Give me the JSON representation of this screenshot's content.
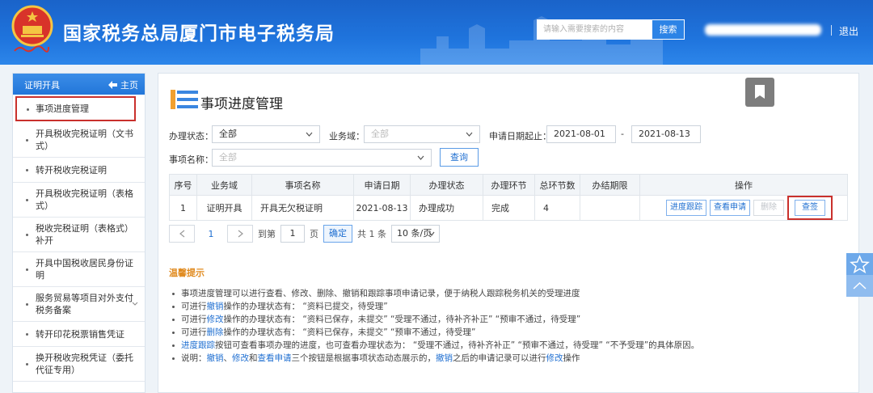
{
  "header": {
    "site_title": "国家税务总局厦门市电子税务局",
    "search_placeholder": "请输入需要搜索的内容",
    "search_button": "搜索",
    "logout": "退出",
    "emblem_text": "中国税务"
  },
  "sidebar": {
    "title": "证明开具",
    "home": "主页",
    "items": [
      {
        "label": "事项进度管理",
        "active": true
      },
      {
        "label": "开具税收完税证明（文书式）"
      },
      {
        "label": "转开税收完税证明"
      },
      {
        "label": "开具税收完税证明（表格式）"
      },
      {
        "label": "税收完税证明（表格式）补开"
      },
      {
        "label": "开具中国税收居民身份证明"
      },
      {
        "label": "服务贸易等项目对外支付税务备案",
        "has_submenu": true
      },
      {
        "label": "转开印花税票销售凭证"
      },
      {
        "label": "换开税收完税凭证（委托代征专用）"
      }
    ]
  },
  "main": {
    "page_title": "事项进度管理",
    "filters": {
      "status_label": "办理状态：",
      "status_value": "全部",
      "domain_label": "业务域：",
      "domain_value": "全部",
      "date_label": "申请日期起止：",
      "date_from": "2021-08-01",
      "date_sep": "-",
      "date_to": "2021-08-13",
      "item_label": "事项名称：",
      "item_value": "全部",
      "query_button": "查询"
    },
    "table": {
      "headers": [
        "序号",
        "业务域",
        "事项名称",
        "申请日期",
        "办理状态",
        "办理环节",
        "总环节数",
        "办结期限",
        "操作"
      ],
      "rows": [
        {
          "index": "1",
          "domain": "证明开具",
          "item": "开具无欠税证明",
          "date": "2021-08-13",
          "status": "办理成功",
          "step": "完成",
          "total_steps": "4",
          "deadline": "",
          "actions": {
            "track": "进度跟踪",
            "view": "查看申请",
            "delete": "删除",
            "sign": "查签"
          }
        }
      ]
    },
    "pager": {
      "current_page": "1",
      "goto_prefix": "到第",
      "goto_value": "1",
      "goto_suffix": "页",
      "confirm": "确定",
      "total": "共 1 条",
      "page_size": "10 条/页"
    },
    "tips": {
      "title": "温馨提示",
      "lines": [
        {
          "parts": [
            {
              "t": "事项进度管理可以进行查看、修改、删除、撤销和跟踪事项申请记录，便于纳税人跟踪税务机关的受理进度"
            }
          ]
        },
        {
          "parts": [
            {
              "t": "可进行"
            },
            {
              "t": "撤销",
              "link": true
            },
            {
              "t": "操作的办理状态有：   “资料已提交，待受理”"
            }
          ]
        },
        {
          "parts": [
            {
              "t": "可进行"
            },
            {
              "t": "修改",
              "link": true
            },
            {
              "t": "操作的办理状态有：   “资料已保存，未提交”    “受理不通过，待补齐补正”    “预审不通过，待受理”"
            }
          ]
        },
        {
          "parts": [
            {
              "t": "可进行"
            },
            {
              "t": "删除",
              "link": true
            },
            {
              "t": "操作的办理状态有：   “资料已保存，未提交”    “预审不通过，待受理”"
            }
          ]
        },
        {
          "parts": [
            {
              "t": "进度跟踪",
              "link": true
            },
            {
              "t": "按钮可查看事项办理的进度，也可查看办理状态为：   “受理不通过，待补齐补正”    “预审不通过，待受理”    “不予受理”的具体原因。"
            }
          ]
        },
        {
          "parts": [
            {
              "t": "说明："
            },
            {
              "t": "撤销",
              "link": true
            },
            {
              "t": "、"
            },
            {
              "t": "修改",
              "link": true
            },
            {
              "t": "和"
            },
            {
              "t": "查看申请",
              "link": true
            },
            {
              "t": "三个按钮是根据事项状态动态展示的，"
            },
            {
              "t": "撤销",
              "link": true
            },
            {
              "t": "之后的申请记录可以进行"
            },
            {
              "t": "修改",
              "link": true
            },
            {
              "t": "操作"
            }
          ]
        }
      ]
    }
  },
  "colors": {
    "header_blue": "#1f74dd",
    "accent_blue": "#1f6fd1",
    "highlight_red": "#c9302c",
    "tip_orange": "#e08a1e"
  },
  "icons": [
    "national-emblem-icon",
    "home-arrow-icon",
    "bullet-icon",
    "chevron-down-icon",
    "page-list-icon",
    "bookmark-icon",
    "prev-page-icon",
    "next-page-icon",
    "star-icon",
    "back-to-top-icon"
  ]
}
